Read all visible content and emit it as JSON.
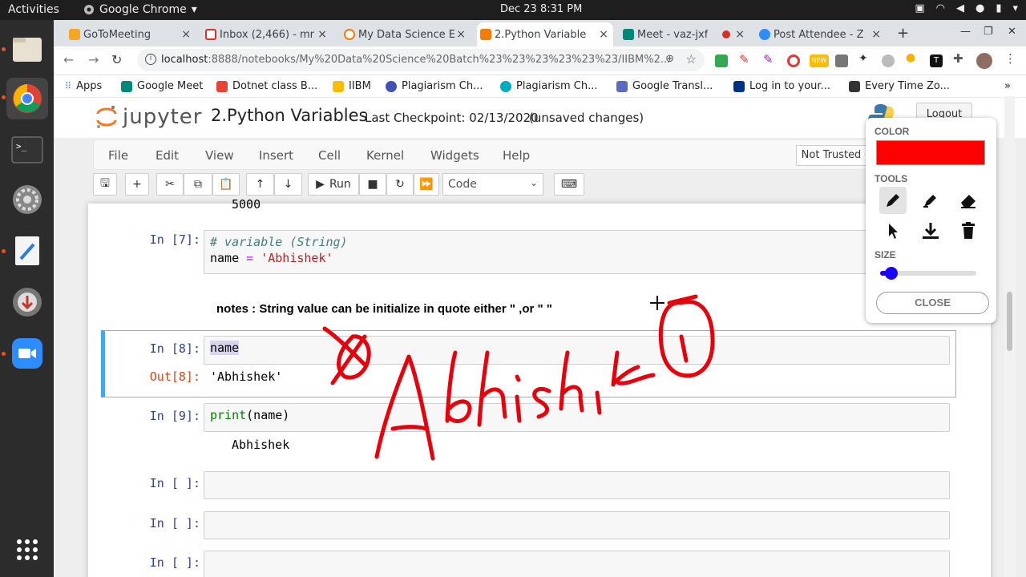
{
  "system": {
    "activities": "Activities",
    "app_name": "Google Chrome",
    "clock": "Dec 23  8:31 PM"
  },
  "tabs": [
    {
      "label": "GoToMeeting",
      "color": "#f5a623"
    },
    {
      "label": "Inbox (2,466) - mr",
      "color": "#d93025"
    },
    {
      "label": "My Data Science E",
      "color": "#f57c00"
    },
    {
      "label": "2.Python Variable",
      "color": "#f57c00"
    },
    {
      "label": "Meet - vaz-jxf",
      "color": "#00897b"
    },
    {
      "label": "Post Attendee - Z",
      "color": "#2d8cff"
    }
  ],
  "address": {
    "host": "localhost",
    "rest": ":8888/notebooks/My%20Data%20Science%20Batch%23%23%23%23%23%23/IIBM%2..."
  },
  "bookmarks": [
    {
      "label": "Apps",
      "color": "#4285f4"
    },
    {
      "label": "Google Meet",
      "color": "#00897b"
    },
    {
      "label": "Dotnet class B...",
      "color": "#ea4335"
    },
    {
      "label": "IIBM",
      "color": "#fbbc05"
    },
    {
      "label": "Plagiarism Ch...",
      "color": "#3f51b5"
    },
    {
      "label": "Plagiarism Ch...",
      "color": "#00acc1"
    },
    {
      "label": "Google Transl...",
      "color": "#5c6bc0"
    },
    {
      "label": "Log in to your...",
      "color": "#003087"
    },
    {
      "label": "Every Time Zo...",
      "color": "#333333"
    }
  ],
  "jupyter": {
    "logo_text": "jupyter",
    "notebook_title": "2.Python Variables",
    "checkpoint": "Last Checkpoint: 02/13/2020",
    "save_status": "(unsaved changes)",
    "logout": "Logout",
    "trust": "Not Trusted",
    "menus": [
      "File",
      "Edit",
      "View",
      "Insert",
      "Cell",
      "Kernel",
      "Widgets",
      "Help"
    ],
    "run_label": "Run",
    "cell_type": "Code"
  },
  "cells": {
    "prev_output": "5000",
    "c7_prompt": "In [7]:",
    "c7_line1": "# variable (String)",
    "c7_var": "name",
    "c7_eq": "=",
    "c7_str": "'Abhishek'",
    "note": "notes : String value can be initialize in quote either \" ,or \" \"",
    "c8_prompt": "In [8]:",
    "c8_code": "name",
    "c8_out_prompt": "Out[8]:",
    "c8_out": "'Abhishek'",
    "c9_prompt": "In [9]:",
    "c9_fn": "print",
    "c9_arg": "(name)",
    "c9_out": "Abhishek",
    "empty_prompt": "In [ ]:"
  },
  "draw_panel": {
    "color_label": "COLOR",
    "color_value": "#ff0000",
    "tools_label": "TOOLS",
    "size_label": "SIZE",
    "size_value": 0.12,
    "close_label": "CLOSE"
  },
  "annotation": {
    "text": "Abhishek",
    "color": "#e8000b"
  }
}
